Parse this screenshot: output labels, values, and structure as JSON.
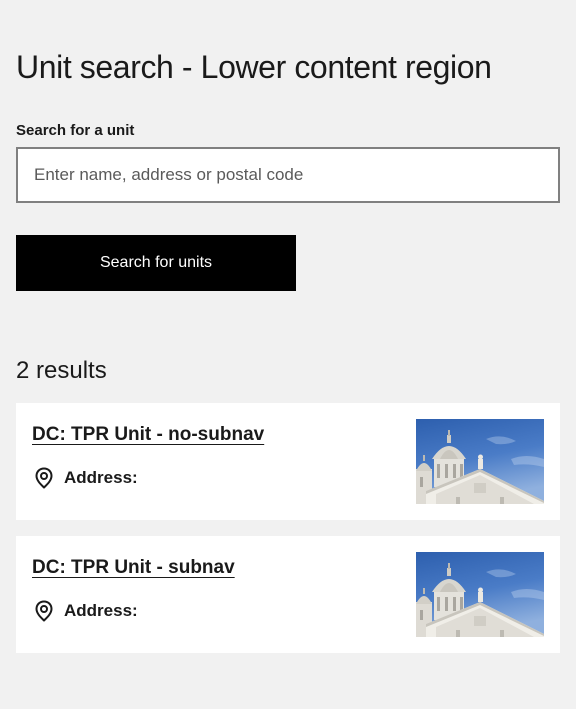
{
  "page": {
    "title": "Unit search - Lower content region"
  },
  "search": {
    "label": "Search for a unit",
    "value": "",
    "placeholder": "Enter name, address or postal code",
    "button_label": "Search for units"
  },
  "results": {
    "count_text": "2 results",
    "items": [
      {
        "title": "DC: TPR Unit - no-subnav",
        "address_label": "Address:",
        "address_icon": "location-pin-icon",
        "image_description": "cathedral-image"
      },
      {
        "title": "DC: TPR Unit - subnav",
        "address_label": "Address:",
        "address_icon": "location-pin-icon",
        "image_description": "cathedral-image"
      }
    ]
  },
  "colors": {
    "background": "#f1f1f1",
    "card_background": "#ffffff",
    "button_background": "#000000",
    "button_text": "#ffffff",
    "input_border": "#808080",
    "text": "#1a1a1a"
  }
}
